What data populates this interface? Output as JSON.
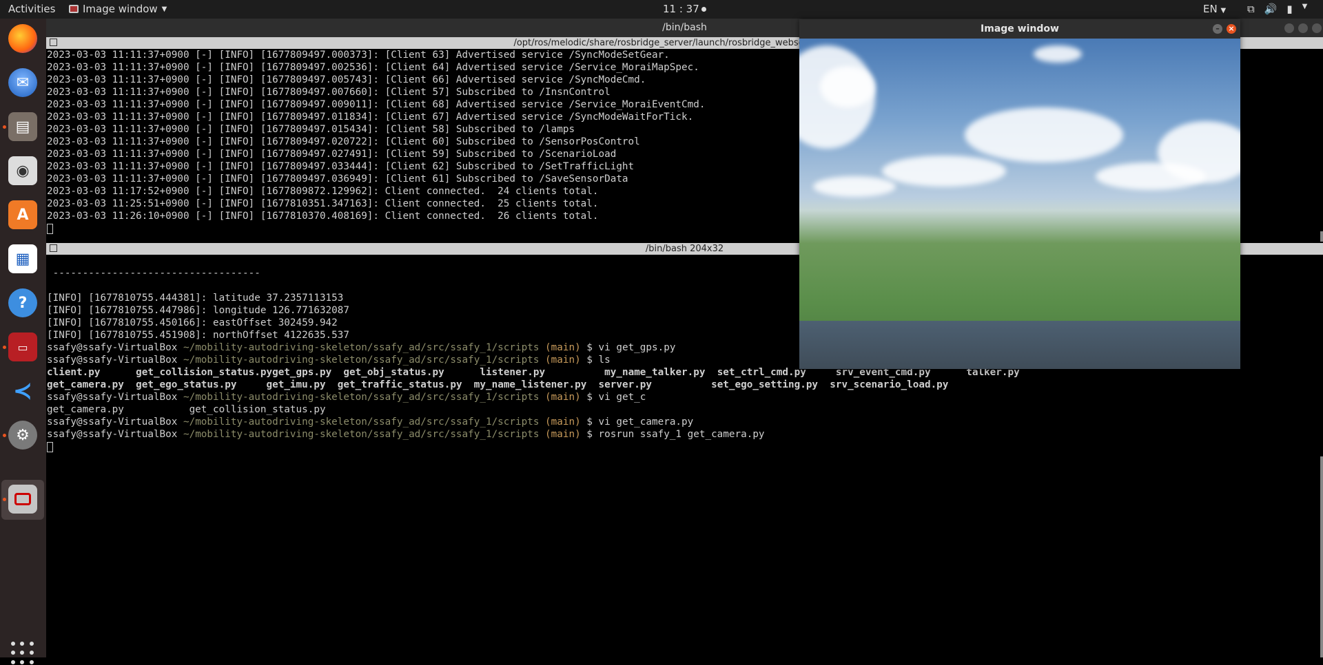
{
  "topbar": {
    "activities": "Activities",
    "app_menu": "Image window",
    "clock": "11 : 37",
    "lang": "EN"
  },
  "dock": {
    "items": [
      "firefox-icon",
      "thunderbird-icon",
      "files-icon",
      "rhythmbox-icon",
      "software-icon",
      "writer-icon",
      "help-icon",
      "terminal-icon",
      "vscode-icon",
      "settings-icon",
      "image-window-icon"
    ],
    "show_apps": "apps-grid-icon"
  },
  "terminal": {
    "title": "/bin/bash",
    "top_pane": {
      "header": "/opt/ros/melodic/share/rosbridge_server/launch/rosbridge_websocket.launch",
      "lines": [
        "2023-03-03 11:11:37+0900 [-] [INFO] [1677809497.000373]: [Client 63] Advertised service /SyncModeSetGear.",
        "2023-03-03 11:11:37+0900 [-] [INFO] [1677809497.002536]: [Client 64] Advertised service /Service_MoraiMapSpec.",
        "2023-03-03 11:11:37+0900 [-] [INFO] [1677809497.005743]: [Client 66] Advertised service /SyncModeCmd.",
        "2023-03-03 11:11:37+0900 [-] [INFO] [1677809497.007660]: [Client 57] Subscribed to /InsnControl",
        "2023-03-03 11:11:37+0900 [-] [INFO] [1677809497.009011]: [Client 68] Advertised service /Service_MoraiEventCmd.",
        "2023-03-03 11:11:37+0900 [-] [INFO] [1677809497.011834]: [Client 67] Advertised service /SyncModeWaitForTick.",
        "2023-03-03 11:11:37+0900 [-] [INFO] [1677809497.015434]: [Client 58] Subscribed to /lamps",
        "2023-03-03 11:11:37+0900 [-] [INFO] [1677809497.020722]: [Client 60] Subscribed to /SensorPosControl",
        "2023-03-03 11:11:37+0900 [-] [INFO] [1677809497.027491]: [Client 59] Subscribed to /ScenarioLoad",
        "2023-03-03 11:11:37+0900 [-] [INFO] [1677809497.033444]: [Client 62] Subscribed to /SetTrafficLight",
        "2023-03-03 11:11:37+0900 [-] [INFO] [1677809497.036949]: [Client 61] Subscribed to /SaveSensorData",
        "2023-03-03 11:17:52+0900 [-] [INFO] [1677809872.129962]: Client connected.  24 clients total.",
        "2023-03-03 11:25:51+0900 [-] [INFO] [1677810351.347163]: Client connected.  25 clients total.",
        "2023-03-03 11:26:10+0900 [-] [INFO] [1677810370.408169]: Client connected.  26 clients total."
      ]
    },
    "bottom_pane": {
      "header": "/bin/bash 204x32",
      "separator": " -----------------------------------",
      "info_lines": [
        "[INFO] [1677810755.444381]: latitude 37.2357113153",
        "[INFO] [1677810755.447986]: longitude 126.771632087",
        "[INFO] [1677810755.450166]: eastOffset 302459.942",
        "[INFO] [1677810755.451908]: northOffset 4122635.537"
      ],
      "prompt_user": "ssafy@ssafy-VirtualBox",
      "prompt_path": "~/mobility-autodriving-skeleton/ssafy_ad/src/ssafy_1/scripts",
      "prompt_branch": "(main)",
      "cmd1": "$ vi get_gps.py",
      "cmd2": "$ ls",
      "ls_row1": [
        "client.py",
        "get_collision_status.py",
        "get_gps.py",
        "get_obj_status.py",
        "listener.py",
        "my_name_talker.py",
        "set_ctrl_cmd.py",
        "srv_event_cmd.py",
        "talker.py"
      ],
      "ls_row2": [
        "get_camera.py",
        "get_ego_status.py",
        "get_imu.py",
        "get_traffic_status.py",
        "my_name_listener.py",
        "server.py",
        "set_ego_setting.py",
        "srv_scenario_load.py"
      ],
      "cmd3": "$ vi get_c",
      "completion": "get_camera.py           get_collision_status.py",
      "cmd4": "$ vi get_camera.py",
      "cmd5": "$ rosrun ssafy_1 get_camera.py"
    }
  },
  "image_window": {
    "title": "Image window"
  }
}
